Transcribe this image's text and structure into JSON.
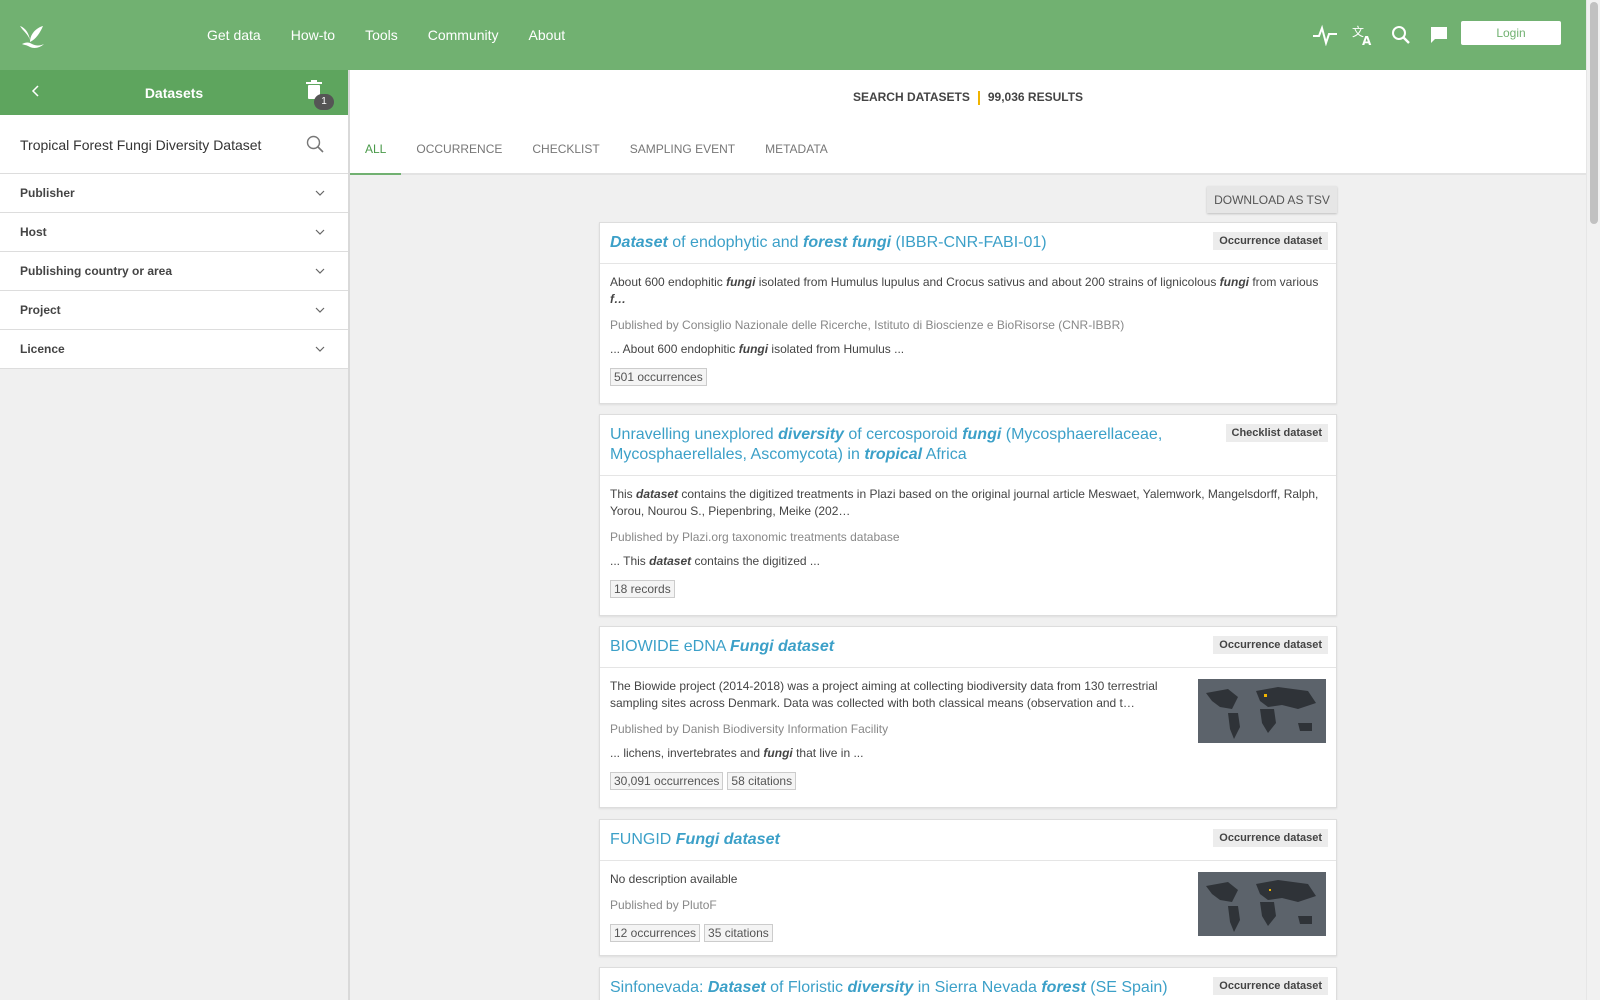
{
  "nav": {
    "items": [
      "Get data",
      "How-to",
      "Tools",
      "Community",
      "About"
    ],
    "login_label": "Login"
  },
  "sidebar": {
    "title": "Datasets",
    "badge_count": "1",
    "search_value": "Tropical Forest Fungi Diversity Dataset",
    "facets": [
      "Publisher",
      "Host",
      "Publishing country or area",
      "Project",
      "Licence"
    ]
  },
  "results": {
    "label": "SEARCH DATASETS",
    "count": "99,036 RESULTS",
    "tabs": [
      "ALL",
      "OCCURRENCE",
      "CHECKLIST",
      "SAMPLING EVENT",
      "METADATA"
    ],
    "active_tab": "ALL",
    "download_label": "DOWNLOAD AS TSV"
  },
  "cards": [
    {
      "title_parts": [
        {
          "t": "Dataset",
          "hl": true
        },
        {
          "t": " of endophytic and ",
          "hl": false
        },
        {
          "t": "forest",
          "hl": true
        },
        {
          "t": " ",
          "hl": false
        },
        {
          "t": "fungi",
          "hl": true
        },
        {
          "t": " (IBBR-CNR-FABI-01)",
          "hl": false
        }
      ],
      "type": "Occurrence dataset",
      "desc_parts": [
        {
          "t": "About 600 endophitic ",
          "hl": false
        },
        {
          "t": "fungi",
          "hl": true
        },
        {
          "t": " isolated from Humulus lupulus and Crocus sativus and about 200 strains of lignicolous ",
          "hl": false
        },
        {
          "t": "fungi",
          "hl": true
        },
        {
          "t": " from various ",
          "hl": false
        },
        {
          "t": "f…",
          "hl": true
        }
      ],
      "publisher": "Published by Consiglio Nazionale delle Ricerche, Istituto di Bioscienze e BioRisorse (CNR-IBBR)",
      "snippet_parts": [
        {
          "t": "... About 600 endophitic ",
          "hl": false
        },
        {
          "t": "fungi",
          "hl": true
        },
        {
          "t": " isolated from Humulus ...",
          "hl": false
        }
      ],
      "chips": [
        "501 occurrences"
      ],
      "map": false
    },
    {
      "title_parts": [
        {
          "t": "Unravelling unexplored ",
          "hl": false
        },
        {
          "t": "diversity",
          "hl": true
        },
        {
          "t": " of cercosporoid ",
          "hl": false
        },
        {
          "t": "fungi",
          "hl": true
        },
        {
          "t": " (Mycosphaerellaceae, Mycosphaerellales, Ascomycota) in ",
          "hl": false
        },
        {
          "t": "tropical",
          "hl": true
        },
        {
          "t": " Africa",
          "hl": false
        }
      ],
      "type": "Checklist dataset",
      "desc_parts": [
        {
          "t": "This ",
          "hl": false
        },
        {
          "t": "dataset",
          "hl": true
        },
        {
          "t": " contains the digitized treatments in Plazi based on the original journal article Meswaet, Yalemwork, Mangelsdorff, Ralph, Yorou, Nourou S., Piepenbring, Meike (202…",
          "hl": false
        }
      ],
      "publisher": "Published by Plazi.org taxonomic treatments database",
      "snippet_parts": [
        {
          "t": "... This ",
          "hl": false
        },
        {
          "t": "dataset",
          "hl": true
        },
        {
          "t": " contains the digitized ...",
          "hl": false
        }
      ],
      "chips": [
        "18 records"
      ],
      "map": false
    },
    {
      "title_parts": [
        {
          "t": "BIOWIDE eDNA ",
          "hl": false
        },
        {
          "t": "Fungi",
          "hl": true
        },
        {
          "t": " ",
          "hl": false
        },
        {
          "t": "dataset",
          "hl": true
        }
      ],
      "type": "Occurrence dataset",
      "desc_parts": [
        {
          "t": "The Biowide project (2014-2018) was a project aiming at collecting biodiversity data from 130 terrestrial sampling sites across Denmark. Data was collected with both classical means (observation and t…",
          "hl": false
        }
      ],
      "publisher": "Published by Danish Biodiversity Information Facility",
      "snippet_parts": [
        {
          "t": "... lichens, invertebrates and ",
          "hl": false
        },
        {
          "t": "fungi",
          "hl": true
        },
        {
          "t": " that live in ...",
          "hl": false
        }
      ],
      "chips": [
        "30,091 occurrences",
        "58 citations"
      ],
      "map": true
    },
    {
      "title_parts": [
        {
          "t": "FUNGID ",
          "hl": false
        },
        {
          "t": "Fungi",
          "hl": true
        },
        {
          "t": " ",
          "hl": false
        },
        {
          "t": "dataset",
          "hl": true
        }
      ],
      "type": "Occurrence dataset",
      "desc_parts": [
        {
          "t": "No description available",
          "hl": false
        }
      ],
      "publisher": "Published by PlutoF",
      "snippet_parts": [],
      "chips": [
        "12 occurrences",
        "35 citations"
      ],
      "map": true
    },
    {
      "title_parts": [
        {
          "t": "Sinfonevada: ",
          "hl": false
        },
        {
          "t": "Dataset",
          "hl": true
        },
        {
          "t": " of Floristic ",
          "hl": false
        },
        {
          "t": "diversity",
          "hl": true
        },
        {
          "t": " in Sierra Nevada ",
          "hl": false
        },
        {
          "t": "forest",
          "hl": true
        },
        {
          "t": " (SE Spain)",
          "hl": false
        }
      ],
      "type": "Occurrence dataset",
      "desc_parts": [],
      "publisher": "",
      "snippet_parts": [],
      "chips": [],
      "map": false
    }
  ],
  "colors": {
    "brand_green": "#71b171",
    "link_blue": "#3ca0c8",
    "accent_yellow": "#f0b400"
  },
  "icons": [
    "gbif-leaf-logo",
    "activity-icon",
    "translate-icon",
    "search-icon",
    "feedback-icon",
    "chevron-left-icon",
    "trash-icon",
    "chevron-down-icon",
    "world-map-thumbnail"
  ]
}
